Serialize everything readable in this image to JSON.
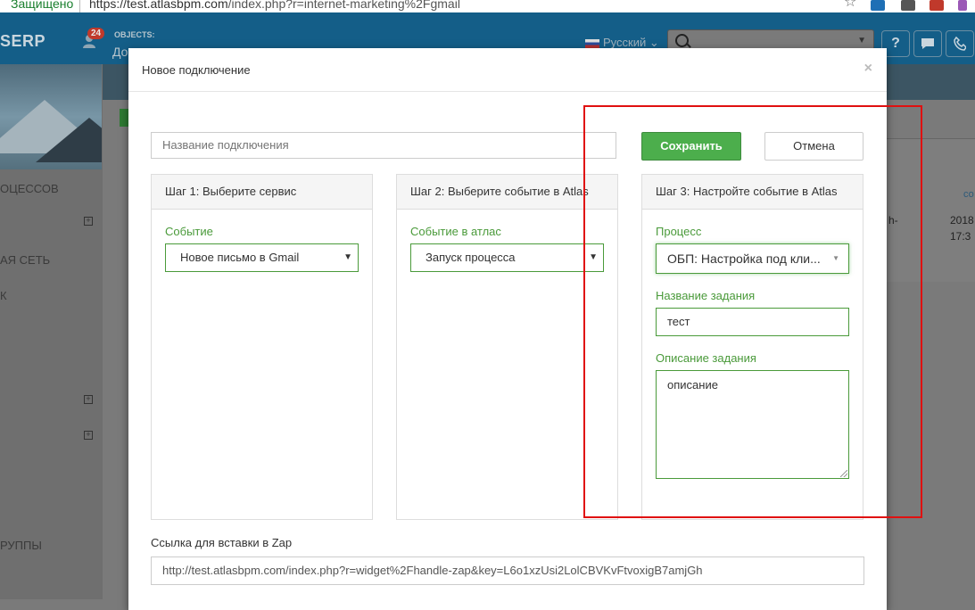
{
  "browser": {
    "secure_label": "Защищено",
    "url_host": "https://test.atlasbpm.com",
    "url_path": "/index.php?r=internet-marketing%2Fgmail",
    "icons": [
      "star-icon",
      "extension-s-icon",
      "extension-vk-icon",
      "extension-abp-icon",
      "extension-pen-icon"
    ]
  },
  "app_header": {
    "logo": "SERP",
    "notification_count": "24",
    "objects_label": "OBJECTS:",
    "objects_sub": "До",
    "language": "Русский",
    "buttons": [
      "?",
      "💬",
      "📞"
    ]
  },
  "background": {
    "side_items": [
      "ОЦЕССОВ",
      "АЯ СЕТЬ",
      "К",
      "РУППЫ"
    ],
    "table_header": "со",
    "table_cells": [
      "h-",
      "2018",
      "17:3"
    ]
  },
  "modal": {
    "title": "Новое подключение",
    "close": "×",
    "connection_name_placeholder": "Название подключения",
    "save_label": "Сохранить",
    "cancel_label": "Отмена",
    "step1": {
      "title": "Шаг 1: Выберите сервис",
      "field_label": "Событие",
      "selected": "Новое письмо в Gmail"
    },
    "step2": {
      "title": "Шаг 2: Выберите событие в Atlas",
      "field_label": "Событие в атлас",
      "selected": "Запуск процесса"
    },
    "step3": {
      "title": "Шаг 3: Настройте событие в Atlas",
      "process_label": "Процесс",
      "process_selected": "ОБП: Настройка под кли...",
      "task_name_label": "Название задания",
      "task_name_value": "тест",
      "task_desc_label": "Описание задания",
      "task_desc_value": "описание"
    },
    "zap_label": "Ссылка для вставки в Zap",
    "zap_url": "http://test.atlasbpm.com/index.php?r=widget%2Fhandle-zap&key=L6o1xzUsi2LolCBVKvFtvoxigB7amjGh"
  },
  "colors": {
    "accent_green": "#4cae4c",
    "label_green": "#4a9a3a",
    "annotation_red": "#e01010",
    "header_blue": "#145e88"
  }
}
